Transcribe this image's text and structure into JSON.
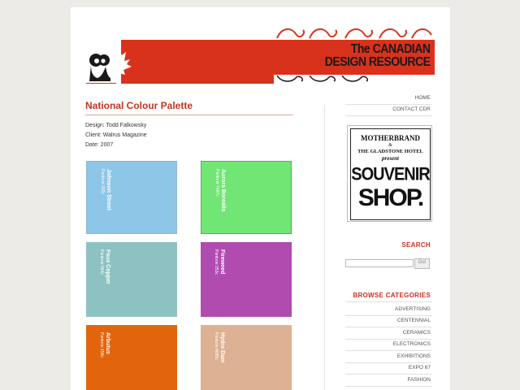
{
  "header": {
    "title_line1": "The CANADIAN",
    "title_line2": "DESIGN RESOURCE"
  },
  "main": {
    "title": "National Colour Palette",
    "designer": "Design: Todd Falkowsky",
    "client": "Client: Walrus Magazine",
    "date": "Date: 2007",
    "swatches_left": [
      {
        "name": "Johnson Street",
        "pantone": "Pantone 292c",
        "color": "#8ec6e8"
      },
      {
        "name": "Faux Copper",
        "pantone": "Pantone 564c",
        "color": "#8ec2c2"
      },
      {
        "name": "Arbutus",
        "pantone": "Pantone 158c",
        "color": "#e2650e"
      }
    ],
    "swatches_right": [
      {
        "name": "Aurora Borealis",
        "pantone": "Pantone 7487c",
        "color": "#72e675"
      },
      {
        "name": "Fireweed",
        "pantone": "Pantone 253c",
        "color": "#b04bb0"
      },
      {
        "name": "Hydro Dam",
        "pantone": "Pantone 4685c",
        "color": "#ddb194"
      }
    ]
  },
  "sidebar": {
    "nav": [
      "HOME",
      "CONTACT CDR"
    ],
    "ad": {
      "line1": "MOTHERBRAND",
      "line2": "&",
      "line3": "THE GLADSTONE HOTEL",
      "line4": "present",
      "line5": "SOUVENIR",
      "line6": "SHOP."
    },
    "search": {
      "heading": "SEARCH",
      "placeholder": "",
      "button": "Go!"
    },
    "categories": {
      "heading": "BROWSE CATEGORIES",
      "items": [
        "ADVERTISING",
        "CENTENNIAL",
        "CERAMICS",
        "ELECTRONICS",
        "EXHIBITIONS",
        "EXPO 67",
        "FASHION"
      ]
    }
  },
  "colors": {
    "accent_red": "#c8321e",
    "banner_red": "#d8321c",
    "page_bg": "#ecebe8"
  }
}
